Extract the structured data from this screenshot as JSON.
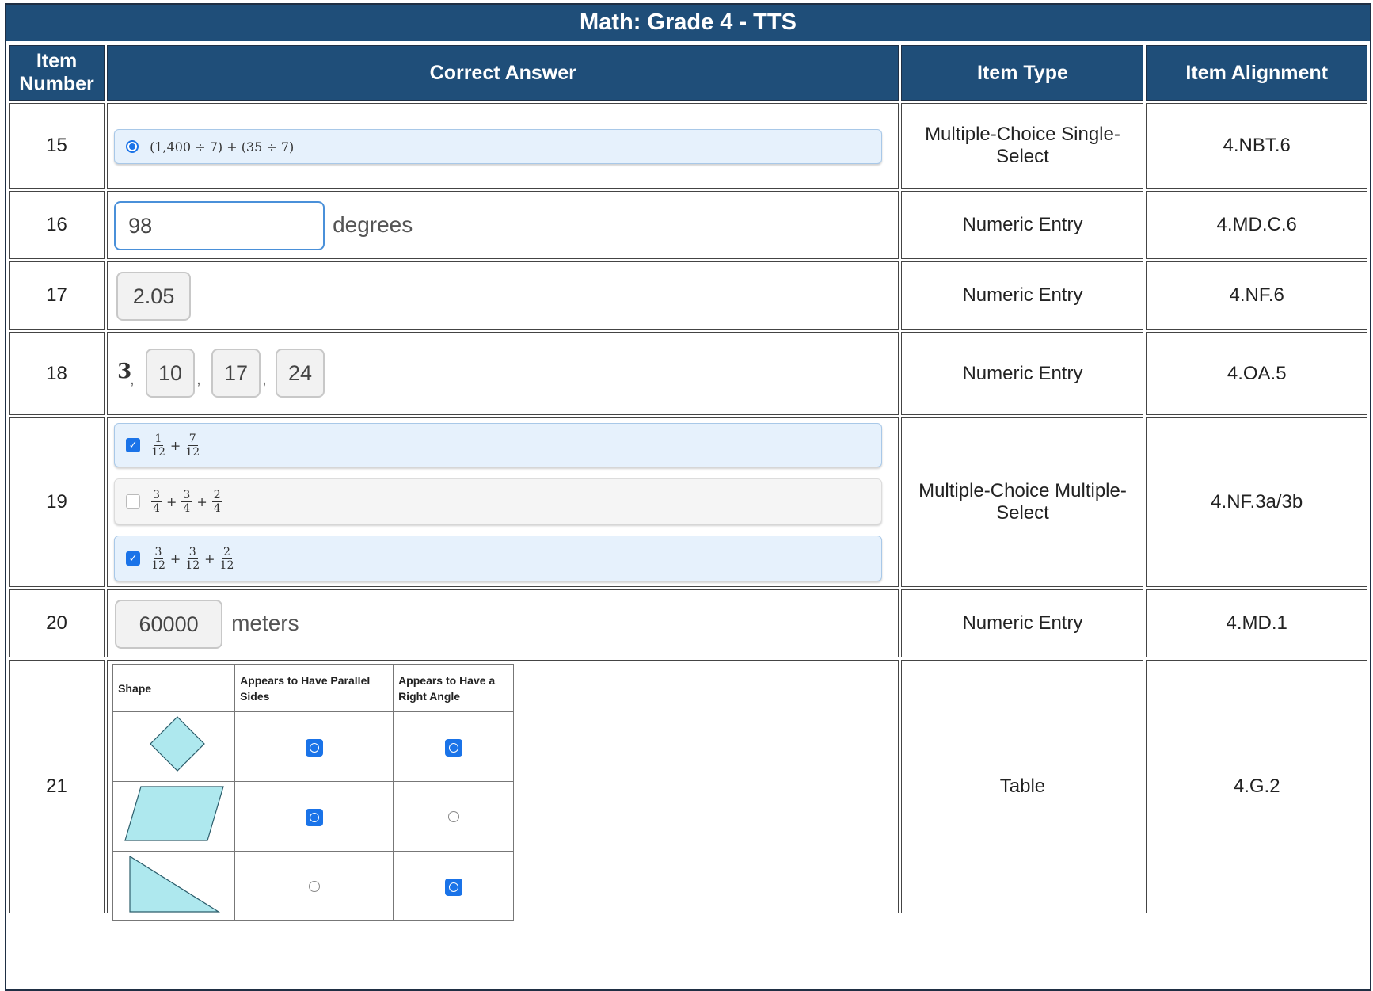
{
  "title": "Math: Grade 4 - TTS",
  "headers": {
    "item_number": "Item Number",
    "correct_answer": "Correct Answer",
    "item_type": "Item Type",
    "item_alignment": "Item Alignment"
  },
  "rows": [
    {
      "number": "15",
      "type": "Multiple-Choice Single-Select",
      "alignment": "4.NBT.6",
      "answer": "(1,400 ÷ 7) + (35 ÷ 7)"
    },
    {
      "number": "16",
      "type": "Numeric Entry",
      "alignment": "4.MD.C.6",
      "value": "98",
      "unit": "degrees"
    },
    {
      "number": "17",
      "type": "Numeric Entry",
      "alignment": "4.NF.6",
      "value": "2.05"
    },
    {
      "number": "18",
      "type": "Numeric Entry",
      "alignment": "4.OA.5",
      "given": "3",
      "values": [
        "10",
        "17",
        "24"
      ]
    },
    {
      "number": "19",
      "type": "Multiple-Choice Multiple-Select",
      "alignment": "4.NF.3a/3b",
      "options": [
        {
          "selected": true,
          "terms": [
            [
              "1",
              "12"
            ],
            [
              "7",
              "12"
            ]
          ]
        },
        {
          "selected": false,
          "terms": [
            [
              "3",
              "4"
            ],
            [
              "3",
              "4"
            ],
            [
              "2",
              "4"
            ]
          ]
        },
        {
          "selected": true,
          "terms": [
            [
              "3",
              "12"
            ],
            [
              "3",
              "12"
            ],
            [
              "2",
              "12"
            ]
          ]
        }
      ]
    },
    {
      "number": "20",
      "type": "Numeric Entry",
      "alignment": "4.MD.1",
      "value": "60000",
      "unit": "meters"
    },
    {
      "number": "21",
      "type": "Table",
      "alignment": "4.G.2",
      "table": {
        "headers": [
          "Shape",
          "Appears to Have Parallel Sides",
          "Appears to Have a Right Angle"
        ],
        "rows": [
          {
            "shape": "rhombus",
            "parallel": true,
            "right_angle": true
          },
          {
            "shape": "parallelogram",
            "parallel": true,
            "right_angle": false
          },
          {
            "shape": "right-triangle",
            "parallel": false,
            "right_angle": true
          }
        ]
      }
    }
  ]
}
